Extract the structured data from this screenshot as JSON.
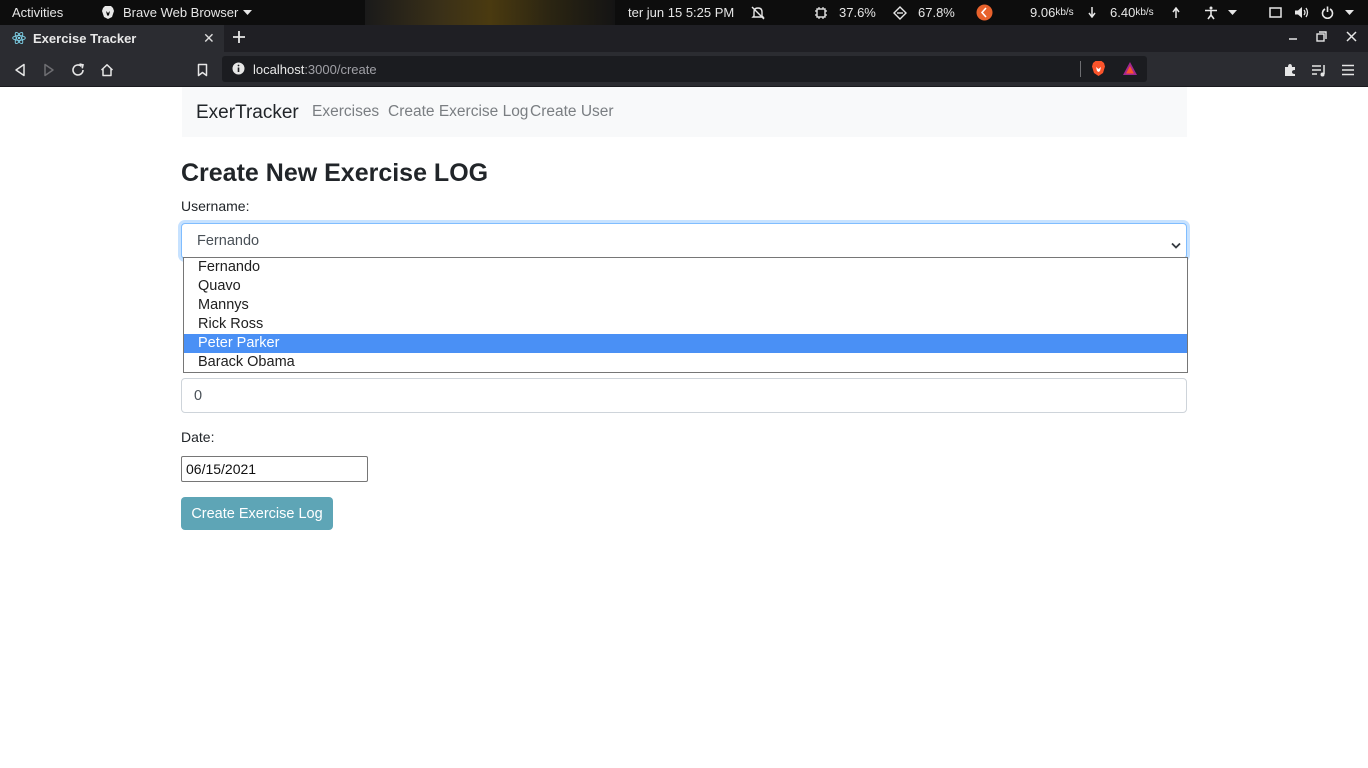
{
  "system_bar": {
    "activities": "Activities",
    "app_name": "Brave Web Browser",
    "datetime": "ter jun 15   5:25 PM",
    "cpu": "37.6%",
    "memory": "67.8%",
    "net_down_value": "9.06",
    "net_down_unit": "kb/s",
    "net_up_value": "6.40",
    "net_up_unit": "kb/s"
  },
  "browser": {
    "tab_title": "Exercise Tracker",
    "url_host": "localhost",
    "url_path": ":3000/create"
  },
  "navbar": {
    "brand": "ExerTracker",
    "links": [
      "Exercises",
      "Create Exercise Log",
      "Create User"
    ]
  },
  "form": {
    "title": "Create New Exercise LOG",
    "username_label": "Username:",
    "username_value": "Fernando",
    "username_options": [
      "Fernando",
      "Quavo",
      "Mannys",
      "Rick Ross",
      "Peter Parker",
      "Barack Obama"
    ],
    "highlighted_option_index": 4,
    "duration_value": "0",
    "date_label": "Date:",
    "date_value": "06/15/2021",
    "submit_label": "Create Exercise Log"
  },
  "colors": {
    "submit_button": "#5ea5b6",
    "option_highlight": "#4a90f5",
    "focus_border": "#80bdff"
  }
}
